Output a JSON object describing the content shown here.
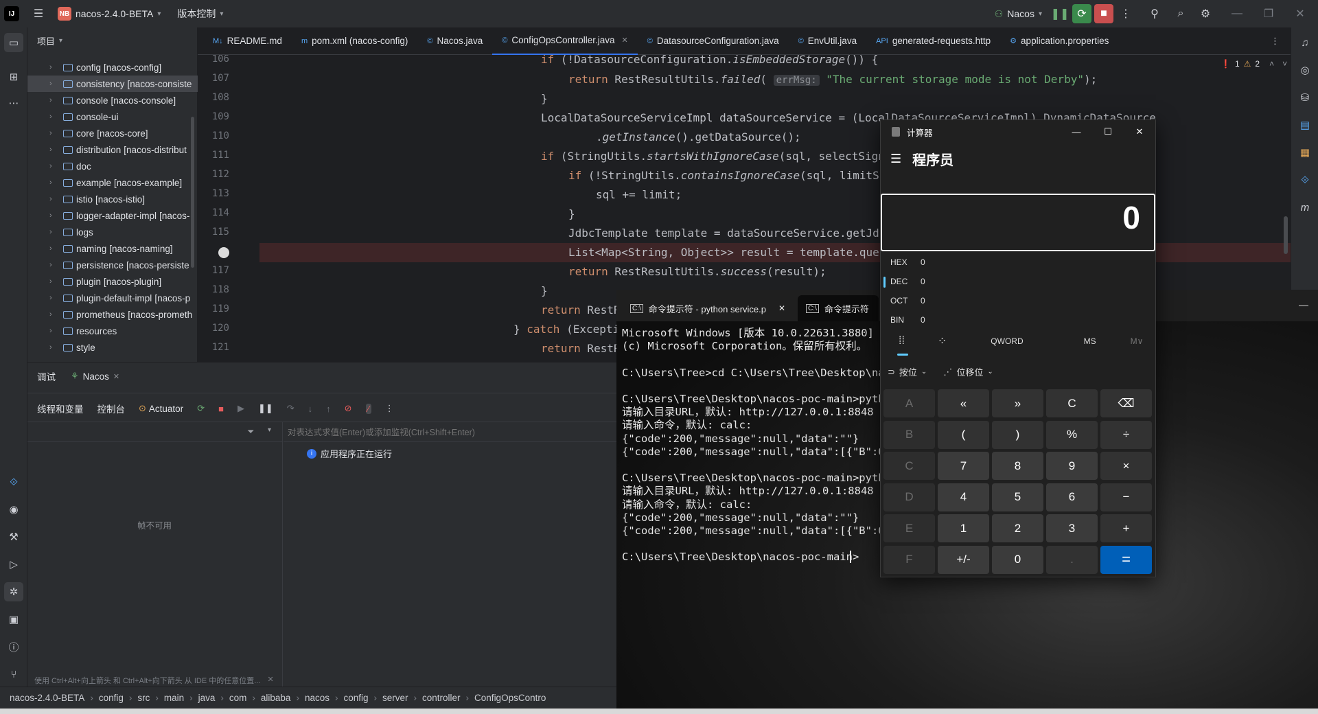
{
  "titlebar": {
    "project_badge": "NB",
    "project_name": "nacos-2.4.0-BETA",
    "vcs": "版本控制",
    "run_config": "Nacos"
  },
  "project_panel": {
    "title": "项目",
    "items": [
      {
        "name": "config",
        "module": "[nacos-config]"
      },
      {
        "name": "consistency",
        "module": "[nacos-consiste"
      },
      {
        "name": "console",
        "module": "[nacos-console]"
      },
      {
        "name": "console-ui",
        "module": ""
      },
      {
        "name": "core",
        "module": "[nacos-core]"
      },
      {
        "name": "distribution",
        "module": "[nacos-distribut"
      },
      {
        "name": "doc",
        "module": ""
      },
      {
        "name": "example",
        "module": "[nacos-example]"
      },
      {
        "name": "istio",
        "module": "[nacos-istio]"
      },
      {
        "name": "logger-adapter-impl",
        "module": "[nacos-"
      },
      {
        "name": "logs",
        "module": ""
      },
      {
        "name": "naming",
        "module": "[nacos-naming]"
      },
      {
        "name": "persistence",
        "module": "[nacos-persiste"
      },
      {
        "name": "plugin",
        "module": "[nacos-plugin]"
      },
      {
        "name": "plugin-default-impl",
        "module": "[nacos-p"
      },
      {
        "name": "prometheus",
        "module": "[nacos-prometh"
      },
      {
        "name": "resources",
        "module": ""
      },
      {
        "name": "style",
        "module": ""
      }
    ]
  },
  "editor": {
    "tabs": [
      {
        "label": "README.md",
        "icon": "M↓"
      },
      {
        "label": "pom.xml (nacos-config)",
        "icon": "m"
      },
      {
        "label": "Nacos.java",
        "icon": "©"
      },
      {
        "label": "ConfigOpsController.java",
        "icon": "©"
      },
      {
        "label": "DatasourceConfiguration.java",
        "icon": "©"
      },
      {
        "label": "EnvUtil.java",
        "icon": "©"
      },
      {
        "label": "generated-requests.http",
        "icon": "API"
      },
      {
        "label": "application.properties",
        "icon": "⚙"
      }
    ],
    "errors": "1",
    "warnings": "2",
    "line_numbers": [
      "106",
      "107",
      "108",
      "109",
      "110",
      "111",
      "112",
      "113",
      "114",
      "115",
      "",
      "117",
      "118",
      "119",
      "120",
      "121"
    ]
  },
  "debug_panel": {
    "tab_debug": "调试",
    "tab_session": "Nacos",
    "sub_threads": "线程和变量",
    "sub_console": "控制台",
    "sub_actuator": "Actuator",
    "frames_unavailable": "帧不可用",
    "eval_placeholder": "对表达式求值(Enter)或添加监视(Ctrl+Shift+Enter)",
    "running_status": "应用程序正在运行",
    "hint": "使用 Ctrl+Alt+向上箭头 和 Ctrl+Alt+向下箭头 从 IDE 中的任意位置..."
  },
  "statusbar": {
    "breadcrumb": [
      "nacos-2.4.0-BETA",
      "config",
      "src",
      "main",
      "java",
      "com",
      "alibaba",
      "nacos",
      "config",
      "server",
      "controller",
      "ConfigOpsContro"
    ]
  },
  "terminal": {
    "tabs": [
      "命令提示符 - python service.p",
      "命令提示符"
    ],
    "lines": [
      "Microsoft Windows [版本 10.0.22631.3880]",
      "(c) Microsoft Corporation。保留所有权利。",
      "",
      "C:\\Users\\Tree>cd C:\\Users\\Tree\\Desktop\\nac",
      "",
      "C:\\Users\\Tree\\Desktop\\nacos-poc-main>pytho",
      "请输入目录URL，默认: http://127.0.0.1:8848",
      "请输入命令，默认: calc:",
      "{\"code\":200,\"message\":null,\"data\":\"\"}",
      "{\"code\":200,\"message\":null,\"data\":[{\"B\":0,",
      "",
      "C:\\Users\\Tree\\Desktop\\nacos-poc-main>pytho",
      "请输入目录URL，默认: http://127.0.0.1:8848",
      "请输入命令，默认: calc:",
      "{\"code\":200,\"message\":null,\"data\":\"\"}",
      "{\"code\":200,\"message\":null,\"data\":[{\"B\":0,",
      "",
      "C:\\Users\\Tree\\Desktop\\nacos-poc-main>"
    ]
  },
  "calculator": {
    "title": "计算器",
    "mode": "程序员",
    "display": "0",
    "bases": [
      {
        "label": "HEX",
        "value": "0"
      },
      {
        "label": "DEC",
        "value": "0"
      },
      {
        "label": "OCT",
        "value": "0"
      },
      {
        "label": "BIN",
        "value": "0"
      }
    ],
    "word_size": "QWORD",
    "ms": "MS",
    "mv": "M∨",
    "bitwise": "按位",
    "bitshift": "位移位",
    "keys": [
      [
        "A",
        "«",
        "»",
        "C",
        "⌫"
      ],
      [
        "B",
        "(",
        ")",
        "%",
        "÷"
      ],
      [
        "C",
        "7",
        "8",
        "9",
        "×"
      ],
      [
        "D",
        "4",
        "5",
        "6",
        "−"
      ],
      [
        "E",
        "1",
        "2",
        "3",
        "+"
      ],
      [
        "F",
        "+/-",
        "0",
        ".",
        "="
      ]
    ]
  }
}
